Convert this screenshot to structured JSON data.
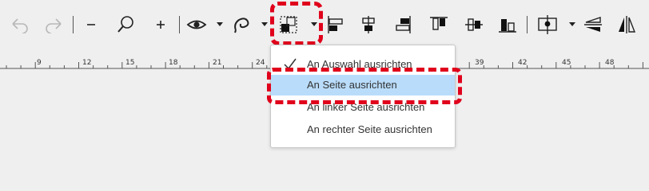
{
  "toolbar": {
    "buttons": [
      {
        "name": "undo-button",
        "icon": "undo-arrow-icon"
      },
      {
        "name": "redo-button",
        "icon": "redo-arrow-icon"
      },
      {
        "name": "zoom-out-button",
        "icon": "minus-icon"
      },
      {
        "name": "zoom-search-button",
        "icon": "magnifier-icon"
      },
      {
        "name": "zoom-in-button",
        "icon": "plus-icon"
      },
      {
        "name": "view-button",
        "icon": "eye-icon"
      },
      {
        "name": "lasso-button",
        "icon": "lasso-icon"
      },
      {
        "name": "align-reference-button",
        "icon": "align-reference-icon"
      },
      {
        "name": "align-left-button",
        "icon": "align-left-icon"
      },
      {
        "name": "align-center-h-button",
        "icon": "align-center-horizontal-icon"
      },
      {
        "name": "align-right-button",
        "icon": "align-right-icon"
      },
      {
        "name": "align-top-button",
        "icon": "align-top-icon"
      },
      {
        "name": "align-middle-v-button",
        "icon": "align-middle-vertical-icon"
      },
      {
        "name": "align-bottom-button",
        "icon": "align-bottom-icon"
      },
      {
        "name": "distribute-button",
        "icon": "distribute-icon"
      },
      {
        "name": "flip-horizontal-button",
        "icon": "flip-horizontal-icon"
      },
      {
        "name": "flip-vertical-button",
        "icon": "flip-vertical-icon"
      }
    ]
  },
  "ruler": {
    "labels": [
      "9",
      "12",
      "15",
      "18",
      "21",
      "24",
      "39",
      "42",
      "45",
      "48"
    ]
  },
  "menu": {
    "items": [
      {
        "label": "An Auswahl ausrichten",
        "checked": true,
        "selected": false
      },
      {
        "label": "An Seite ausrichten",
        "checked": false,
        "selected": true
      },
      {
        "label": "An linker Seite ausrichten",
        "checked": false,
        "selected": false
      },
      {
        "label": "An rechter Seite ausrichten",
        "checked": false,
        "selected": false
      }
    ]
  },
  "colors": {
    "annotation": "#e0001b",
    "selected_item": "#b9dcfa",
    "background": "#efefef"
  }
}
